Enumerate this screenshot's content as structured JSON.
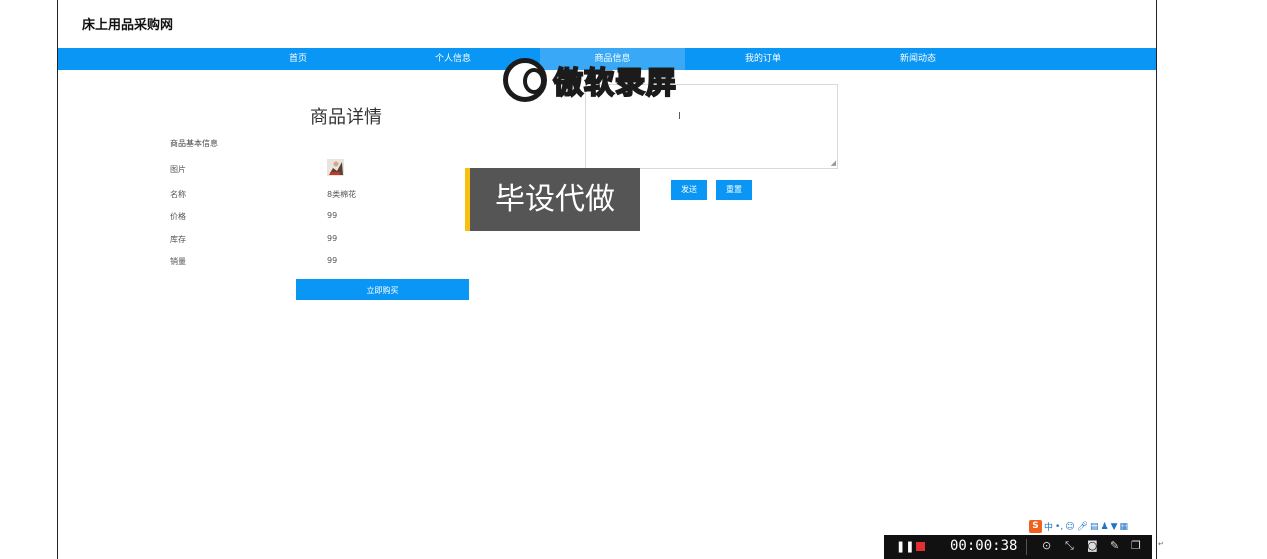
{
  "site": {
    "title": "床上用品采购网"
  },
  "nav": {
    "items": [
      "首页",
      "个人信息",
      "商品信息",
      "我的订单",
      "新闻动态"
    ],
    "active_index": 2
  },
  "detail": {
    "title": "商品详情",
    "section_label": "商品基本信息",
    "rows": [
      {
        "label": "图片",
        "value": ""
      },
      {
        "label": "名称",
        "value": "8类棉花"
      },
      {
        "label": "价格",
        "value": "99"
      },
      {
        "label": "库存",
        "value": "99"
      },
      {
        "label": "销量",
        "value": "99"
      }
    ],
    "buy_label": "立即购买"
  },
  "comment": {
    "send_label": "发送",
    "reset_label": "重置",
    "caret": "I"
  },
  "overlays": {
    "watermark": "傲软录屏",
    "badge": "毕设代做"
  },
  "recorder": {
    "time": "00:00:38"
  },
  "ime": {
    "lang": "中"
  },
  "colors": {
    "nav": "#0a96f5",
    "badge_bg": "#555555",
    "badge_accent": "#f5c010"
  }
}
